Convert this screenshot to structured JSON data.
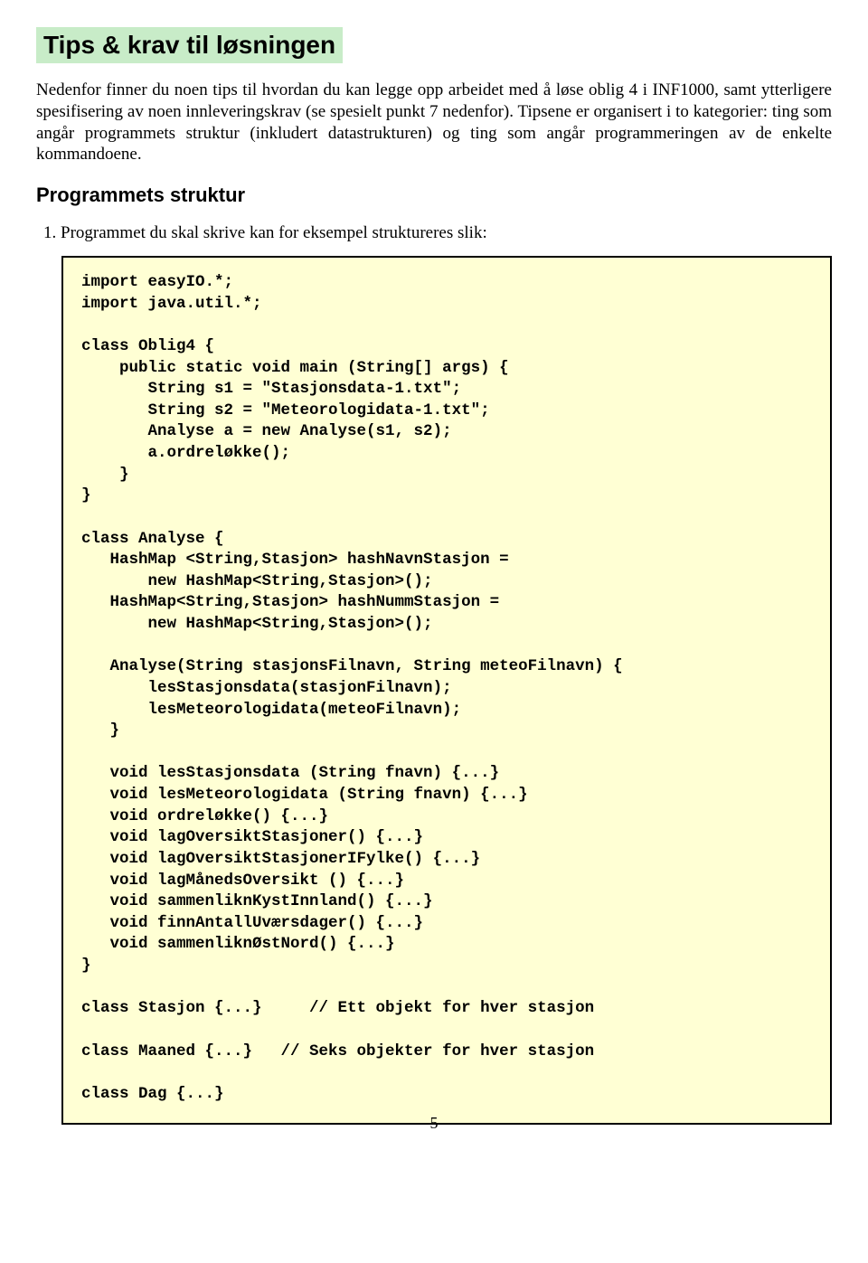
{
  "title": "Tips & krav til løsningen",
  "intro": "Nedenfor finner du noen tips til hvordan du kan legge opp arbeidet med å løse oblig 4 i INF1000, samt ytterligere spesifisering av noen innleveringskrav (se spesielt punkt 7 nedenfor). Tipsene er organisert i to kategorier: ting som angår programmets struktur (inkludert datastrukturen) og ting som angår programmeringen av de enkelte kommandoene.",
  "section_heading": "Programmets struktur",
  "list_item": "1. Programmet du skal skrive kan for eksempel struktureres slik:",
  "code": "import easyIO.*;\nimport java.util.*;\n\nclass Oblig4 {\n    public static void main (String[] args) {\n       String s1 = \"Stasjonsdata-1.txt\";\n       String s2 = \"Meteorologidata-1.txt\";\n       Analyse a = new Analyse(s1, s2);\n       a.ordreløkke();\n    }\n}\n\nclass Analyse {\n   HashMap <String,Stasjon> hashNavnStasjon =\n       new HashMap<String,Stasjon>();\n   HashMap<String,Stasjon> hashNummStasjon =\n       new HashMap<String,Stasjon>();\n\n   Analyse(String stasjonsFilnavn, String meteoFilnavn) {\n       lesStasjonsdata(stasjonFilnavn);\n       lesMeteorologidata(meteoFilnavn);\n   }\n\n   void lesStasjonsdata (String fnavn) {...}\n   void lesMeteorologidata (String fnavn) {...}\n   void ordreløkke() {...}\n   void lagOversiktStasjoner() {...}\n   void lagOversiktStasjonerIFylke() {...}\n   void lagMånedsOversikt () {...}\n   void sammenliknKystInnland() {...}\n   void finnAntallUværsdager() {...}\n   void sammenliknØstNord() {...}\n}\n\nclass Stasjon {...}     // Ett objekt for hver stasjon\n\nclass Maaned {...}   // Seks objekter for hver stasjon\n\nclass Dag {...}",
  "page_number": "5"
}
